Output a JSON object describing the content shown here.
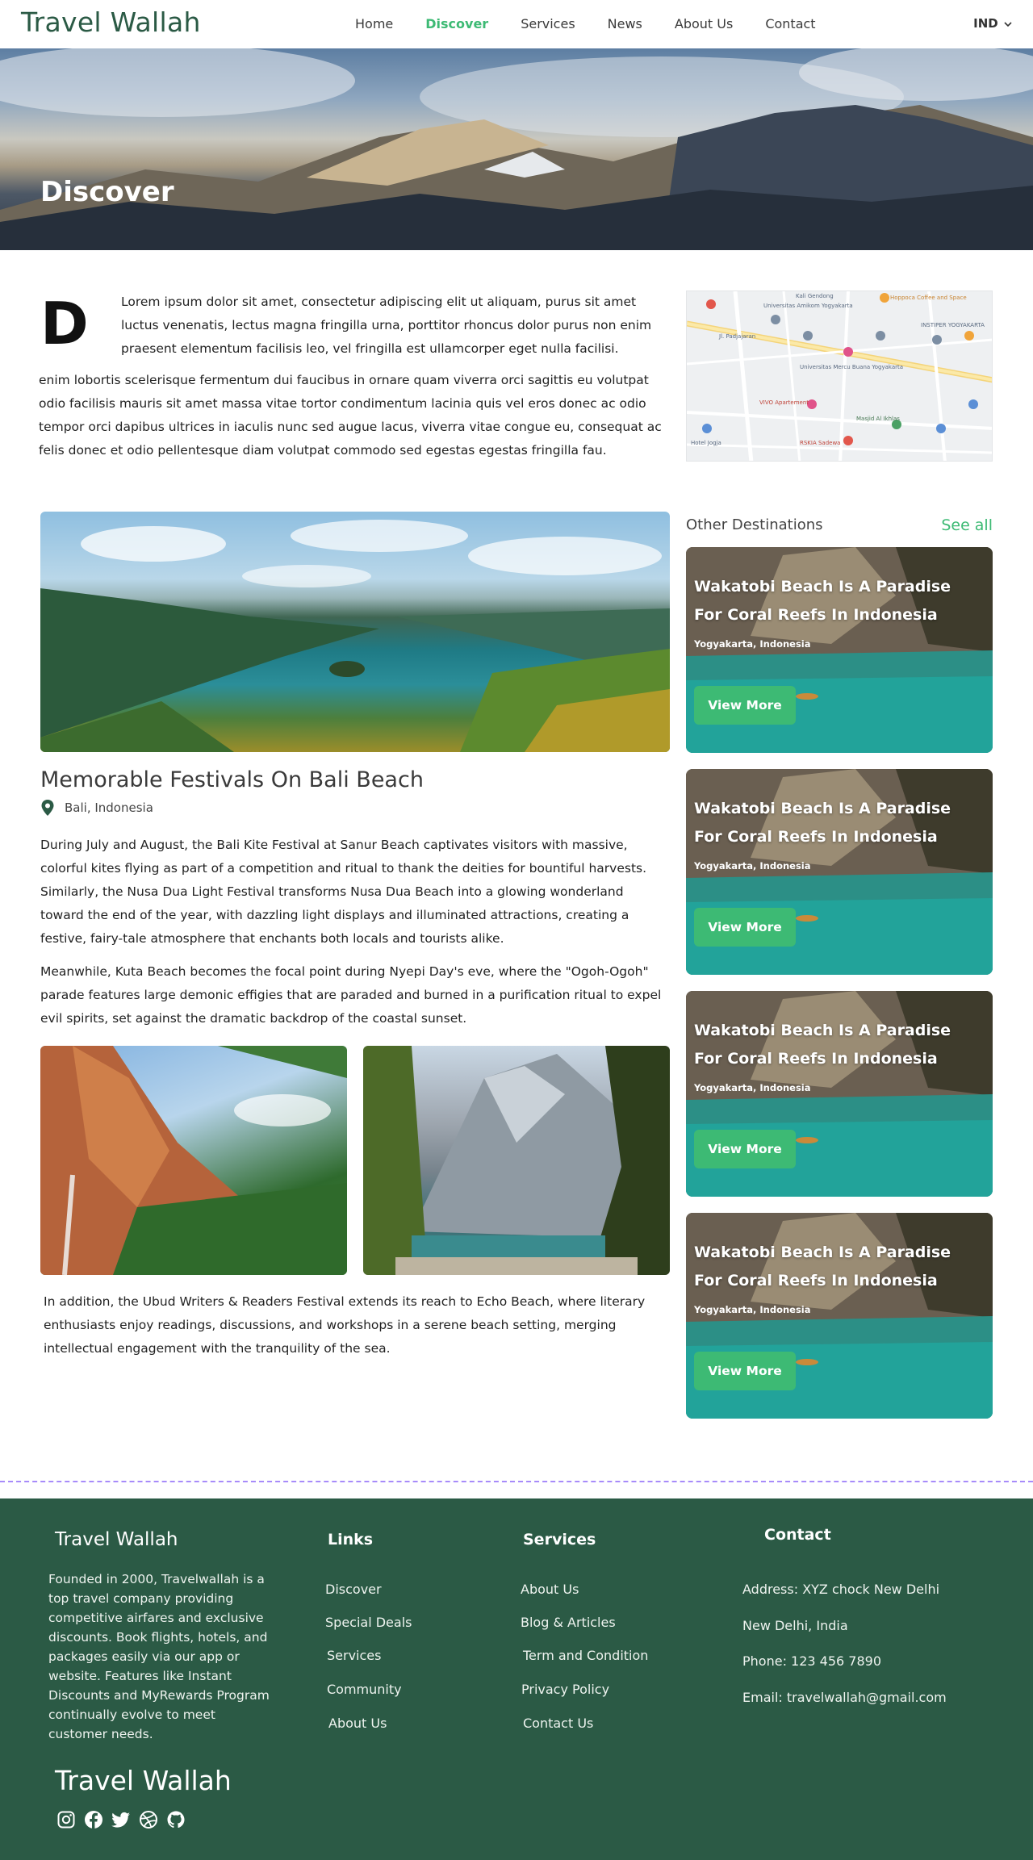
{
  "nav": {
    "brand": "Travel Wallah",
    "links": [
      {
        "label": "Home",
        "active": false
      },
      {
        "label": "Discover",
        "active": true
      },
      {
        "label": "Services",
        "active": false
      },
      {
        "label": "News",
        "active": false
      },
      {
        "label": "About Us",
        "active": false
      },
      {
        "label": "Contact",
        "active": false
      }
    ],
    "language": "IND"
  },
  "hero": {
    "title": "Discover"
  },
  "intro": {
    "dropcap": "D",
    "text_a": "Lorem ipsum dolor sit amet, consectetur adipiscing elit ut aliquam, purus sit amet luctus venenatis, lectus magna fringilla urna, porttitor rhoncus dolor purus non enim praesent elementum facilisis leo, vel fringilla est ullamcorper eget nulla facilisi.",
    "text_b": "enim lobortis scelerisque fermentum dui faucibus in ornare quam viverra orci sagittis eu volutpat odio facilisis mauris sit amet massa vitae tortor condimentum lacinia quis vel eros donec ac odio tempor orci dapibus ultrices in iaculis nunc sed augue lacus, viverra vitae congue eu, consequat ac felis donec et odio pellentesque diam volutpat commodo sed egestas egestas fringilla fau."
  },
  "article": {
    "title": "Memorable Festivals On Bali Beach",
    "location": "Bali, Indonesia",
    "paragraphs": [
      "During July and August, the Bali Kite Festival at Sanur Beach captivates visitors with massive, colorful kites flying as part of a competition and ritual to thank the deities for bountiful harvests. Similarly, the Nusa Dua Light Festival transforms Nusa Dua Beach into a glowing wonderland toward the end of the year, with dazzling light displays and illuminated attractions, creating a festive, fairy-tale atmosphere that enchants both locals and tourists alike.",
      "Meanwhile, Kuta Beach becomes the focal point during Nyepi Day's eve, where the \"Ogoh-Ogoh\" parade features large demonic effigies that are paraded and burned in a purification ritual to expel evil spirits, set against the dramatic backdrop of the coastal sunset.",
      "In addition, the Ubud Writers & Readers Festival extends its reach to Echo Beach, where literary enthusiasts enjoy readings, discussions, and workshops in a serene beach setting, merging intellectual engagement with the tranquility of the sea."
    ]
  },
  "sidebar": {
    "title": "Other Destinations",
    "see_all": "See all",
    "cards": [
      {
        "title": "Wakatobi Beach Is A Paradise For Coral Reefs In Indonesia",
        "location": "Yogyakarta, Indonesia",
        "button": "View More"
      },
      {
        "title": "Wakatobi Beach Is A Paradise For Coral Reefs In Indonesia",
        "location": "Yogyakarta, Indonesia",
        "button": "View More"
      },
      {
        "title": "Wakatobi Beach Is A Paradise For Coral Reefs In Indonesia",
        "location": "Yogyakarta, Indonesia",
        "button": "View More"
      },
      {
        "title": "Wakatobi Beach Is A Paradise For Coral Reefs In Indonesia",
        "location": "Yogyakarta, Indonesia",
        "button": "View More"
      }
    ]
  },
  "map": {
    "labels": [
      "Kali Gendong",
      "Universitas Amikom Yogyakarta",
      "INSTIPER YOGYAKARTA",
      "Universitas Mercu Buana Yogyakarta",
      "VIVO Apartement",
      "Jl. Padjajaran",
      "Masjid Al Ikhlas",
      "RSKIA Sadewa",
      "Hotel Jogja",
      "Hoppoca Coffee and Space"
    ]
  },
  "footer": {
    "brand": "Travel Wallah",
    "about": "Founded in 2000, Travelwallah is a top travel company providing competitive airfares and exclusive discounts. Book flights, hotels, and packages easily via our app or website. Features like Instant Discounts and MyRewards Program continually evolve to meet customer needs.",
    "links_title": "Links",
    "links": [
      "Discover",
      "Special Deals",
      "Services",
      "Community",
      "About Us"
    ],
    "services_title": "Services",
    "services": [
      "About Us",
      "Blog & Articles",
      "Term and Condition",
      "Privacy Policy",
      "Contact Us"
    ],
    "contact_title": "Contact",
    "contact": [
      "Address: XYZ chock New Delhi",
      "New Delhi, India",
      "Phone: 123 456 7890",
      "Email: travelwallah@gmail.com"
    ],
    "brand_bottom": "Travel Wallah",
    "socials": [
      "instagram-icon",
      "facebook-icon",
      "twitter-icon",
      "dribbble-icon",
      "github-icon"
    ]
  },
  "colors": {
    "accent": "#3dba74",
    "brand_green": "#2b5a45",
    "divider": "#a78bfa"
  }
}
